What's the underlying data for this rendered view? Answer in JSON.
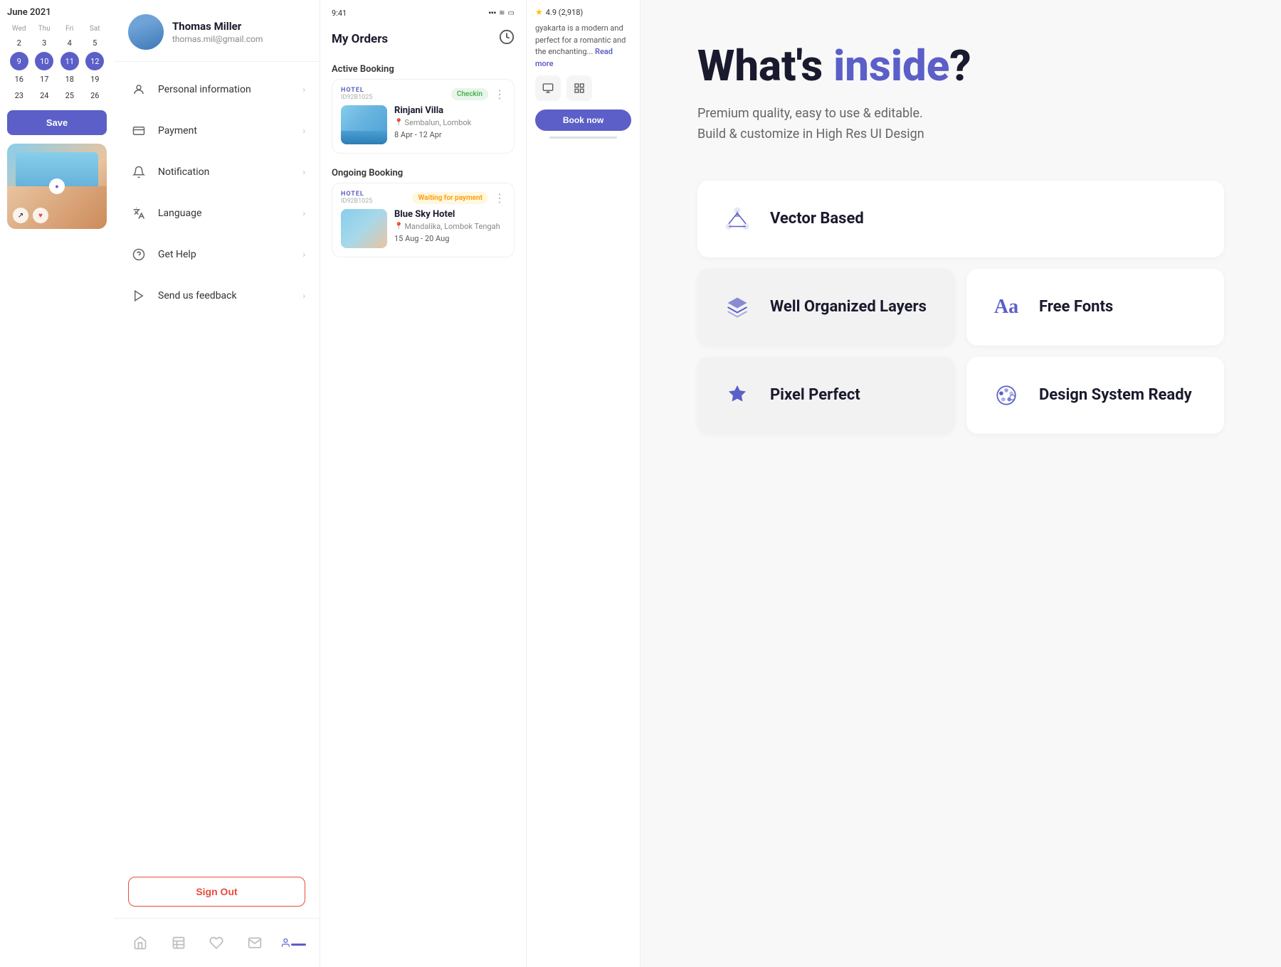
{
  "calendar": {
    "month_year": "June 2021",
    "day_labels": [
      "Wed",
      "Thu",
      "Fri",
      "Sat"
    ],
    "weeks": [
      [
        "2",
        "3",
        "4",
        "5"
      ],
      [
        "9",
        "10",
        "11",
        "12"
      ],
      [
        "16",
        "17",
        "18",
        "19"
      ],
      [
        "23",
        "24",
        "25",
        "26"
      ]
    ],
    "highlighted_days": [
      "9",
      "10",
      "11",
      "12"
    ]
  },
  "save_button": {
    "label": "Save"
  },
  "profile": {
    "name": "Thomas Miller",
    "email": "thomas.mil@gmail.com"
  },
  "menu_items": [
    {
      "id": "personal-info",
      "label": "Personal information",
      "icon": "person"
    },
    {
      "id": "payment",
      "label": "Payment",
      "icon": "card"
    },
    {
      "id": "notification",
      "label": "Notification",
      "icon": "bell"
    },
    {
      "id": "language",
      "label": "Language",
      "icon": "translate"
    },
    {
      "id": "get-help",
      "label": "Get Help",
      "icon": "help"
    },
    {
      "id": "send-feedback",
      "label": "Send us feedback",
      "icon": "arrow"
    }
  ],
  "sign_out": {
    "label": "Sign Out"
  },
  "orders": {
    "title": "My Orders",
    "status_time": "9:41",
    "active_booking_label": "Active Booking",
    "ongoing_booking_label": "Ongoing Booking",
    "active": {
      "hotel_label": "HOTEL",
      "hotel_id": "ID92B1025",
      "badge": "Checkin",
      "name": "Rinjani Villa",
      "location": "Sembalun, Lombok",
      "dates": "8 Apr - 12 Apr"
    },
    "ongoing": {
      "hotel_label": "HOTEL",
      "hotel_id": "ID92B1025",
      "badge": "Waiting for payment",
      "name": "Blue Sky Hotel",
      "location": "Mandalika, Lombok Tengah",
      "dates": "15 Aug - 20 Aug"
    }
  },
  "hotel_desc": {
    "text": "gyakarta is a modern and perfect for a romantic and the enchanting...",
    "read_more": "Read more",
    "rating": "4.9 (2,918)"
  },
  "book_now": {
    "label": "Book now"
  },
  "main": {
    "heading_part1": "What's ",
    "heading_colored": "inside",
    "heading_part2": "?",
    "sub_line1": "Premium quality, easy to use & editable.",
    "sub_line2": "Build & customize in High Res UI Design",
    "features": [
      {
        "id": "vector-based",
        "label": "Vector Based",
        "icon": "vector",
        "wide": true
      },
      {
        "id": "well-organized",
        "label": "Well Organized Layers",
        "icon": "layers",
        "wide": false
      },
      {
        "id": "free-fonts",
        "label": "Free Fonts",
        "icon": "fonts",
        "wide": false
      },
      {
        "id": "pixel-perfect",
        "label": "Pixel Perfect",
        "icon": "star",
        "wide": false
      },
      {
        "id": "design-system",
        "label": "Design System Ready",
        "icon": "palette",
        "wide": false
      }
    ]
  }
}
